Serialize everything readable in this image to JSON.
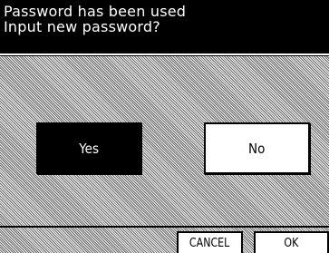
{
  "header": {
    "line1": "Password has been used",
    "line2": "Input new password?"
  },
  "dialog": {
    "yes_label": "Yes",
    "no_label": "No"
  },
  "footer": {
    "cancel_label": "CANCEL",
    "ok_label": "OK"
  },
  "colors": {
    "header_bg": "#000000",
    "header_text": "#ffffff",
    "selected_bg": "#000000",
    "unselected_bg": "#ffffff"
  }
}
